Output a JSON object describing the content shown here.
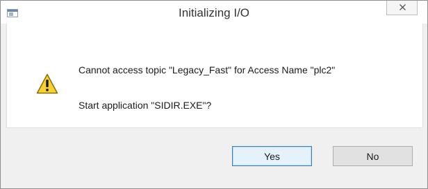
{
  "window": {
    "title": "Initializing I/O",
    "app_icon": "application-window-icon",
    "close_icon": "close-icon"
  },
  "message": {
    "icon": "warning-icon",
    "line1": "Cannot access topic \"Legacy_Fast\" for Access Name \"plc2\"",
    "line2": "Start application \"SIDIR.EXE\"?"
  },
  "buttons": {
    "yes_label": "Yes",
    "no_label": "No"
  },
  "colors": {
    "default_button_border": "#3c7fb1",
    "warning_yellow": "#f7d13b"
  }
}
